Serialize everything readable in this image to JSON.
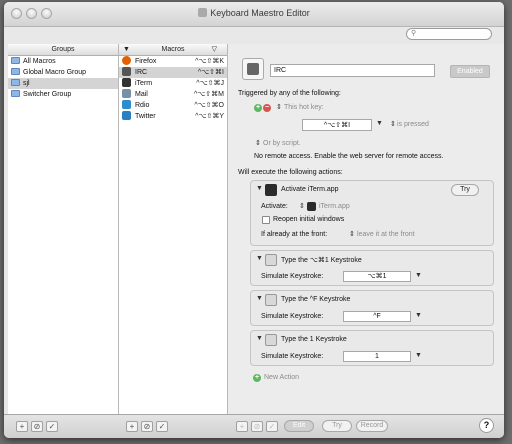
{
  "window": {
    "title": "Keyboard Maestro Editor"
  },
  "search": {
    "placeholder": ""
  },
  "groups": {
    "header": "Groups",
    "items": [
      {
        "label": "All Macros",
        "selected": false
      },
      {
        "label": "Global Macro Group",
        "selected": false
      },
      {
        "label": "sjl",
        "selected": true
      },
      {
        "label": "Switcher Group",
        "selected": false
      }
    ]
  },
  "macros": {
    "header": "Macros",
    "items": [
      {
        "label": "Firefox",
        "hotkey": "^⌥⇧⌘K",
        "icon": "firefox-icon",
        "color": "#e66000",
        "selected": false
      },
      {
        "label": "IRC",
        "hotkey": "^⌥⇧⌘I",
        "icon": "irc-icon",
        "color": "#555555",
        "selected": true
      },
      {
        "label": "iTerm",
        "hotkey": "^⌥⇧⌘J",
        "icon": "iterm-icon",
        "color": "#333333",
        "selected": false
      },
      {
        "label": "Mail",
        "hotkey": "^⌥⇧⌘M",
        "icon": "mail-icon",
        "color": "#7a8fa6",
        "selected": false
      },
      {
        "label": "Rdio",
        "hotkey": "^⌥⇧⌘O",
        "icon": "rdio-icon",
        "color": "#2b8ccf",
        "selected": false
      },
      {
        "label": "Twitter",
        "hotkey": "^⌥⇧⌘Y",
        "icon": "twitter-icon",
        "color": "#2a7fc3",
        "selected": false
      }
    ]
  },
  "editor": {
    "macro_name": "IRC",
    "enabled_label": "Enabled",
    "triggered_label": "Triggered by any of the following:",
    "hotkey_trigger_label": "This hot key:",
    "hotkey_value": "^⌥⇧⌘I",
    "hotkey_condition": "is pressed",
    "script_label": "Or by script.",
    "remote_text": "No remote access.  Enable the web server for remote access.",
    "execute_label": "Will execute the following actions:",
    "actions": {
      "activate": {
        "title": "Activate iTerm.app",
        "try_label": "Try",
        "activate_label": "Activate:",
        "app_value": "iTerm.app",
        "reopen_label": "Reopen initial windows",
        "front_label": "If already at the front:",
        "front_value": "leave it at the front"
      },
      "keystroke1": {
        "title": "Type the ⌥⌘1 Keystroke",
        "sim_label": "Simulate Keystroke:",
        "value": "⌥⌘1"
      },
      "keystroke2": {
        "title": "Type the ^F Keystroke",
        "sim_label": "Simulate Keystroke:",
        "value": "^F"
      },
      "keystroke3": {
        "title": "Type the 1 Keystroke",
        "sim_label": "Simulate Keystroke:",
        "value": "1"
      }
    },
    "new_action_label": "New Action"
  },
  "bottom": {
    "edit_label": "Edit",
    "try_label": "Try",
    "record_label": "Record",
    "help_label": "?"
  }
}
